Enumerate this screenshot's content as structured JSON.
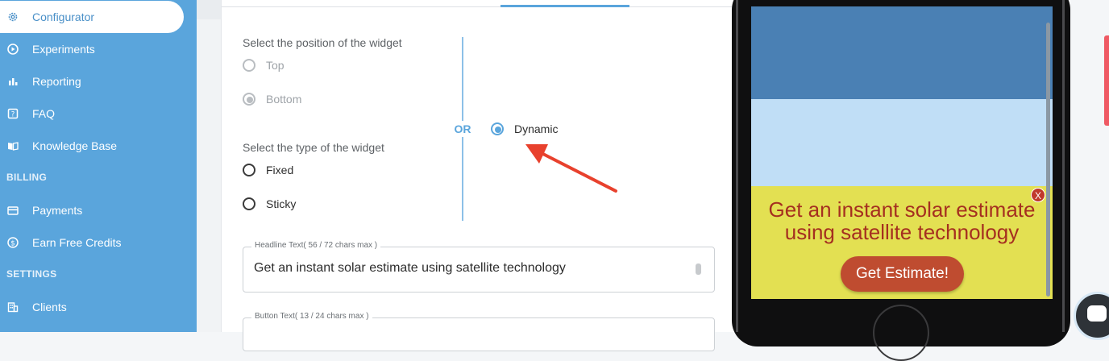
{
  "sidebar": {
    "items": [
      {
        "label": "Configurator",
        "icon": "gear-icon",
        "active": true
      },
      {
        "label": "Experiments",
        "icon": "play-circle-icon"
      },
      {
        "label": "Reporting",
        "icon": "bar-chart-icon"
      },
      {
        "label": "FAQ",
        "icon": "question-box-icon"
      },
      {
        "label": "Knowledge Base",
        "icon": "book-icon"
      },
      {
        "label": "Payments",
        "icon": "credit-card-icon"
      },
      {
        "label": "Earn Free Credits",
        "icon": "dollar-circle-icon"
      },
      {
        "label": "Clients",
        "icon": "building-icon"
      }
    ],
    "sections": {
      "billing": "BILLING",
      "settings": "SETTINGS"
    },
    "colors": {
      "background": "#5aa5dc",
      "active_text": "#4a90c8"
    }
  },
  "form": {
    "position_label": "Select the position of the widget",
    "position_options": [
      {
        "label": "Top",
        "checked": false,
        "disabled": true
      },
      {
        "label": "Bottom",
        "checked": true,
        "disabled": true
      }
    ],
    "or_label": "OR",
    "dynamic_option": {
      "label": "Dynamic",
      "checked": true
    },
    "type_label": "Select the type of the widget",
    "type_options": [
      {
        "label": "Fixed",
        "checked": false
      },
      {
        "label": "Sticky",
        "checked": false
      }
    ],
    "headline": {
      "legend": "Headline Text( 56 / 72 chars max )",
      "value": "Get an instant solar estimate using satellite technology"
    },
    "button": {
      "legend": "Button Text( 13 / 24 chars max )"
    }
  },
  "preview": {
    "headline": "Get an instant solar estimate using satellite technology",
    "button_label": "Get Estimate!",
    "close_label": "X",
    "colors": {
      "ad_background": "#e3e052",
      "headline": "#a52f20",
      "button": "#bf4c30"
    }
  }
}
